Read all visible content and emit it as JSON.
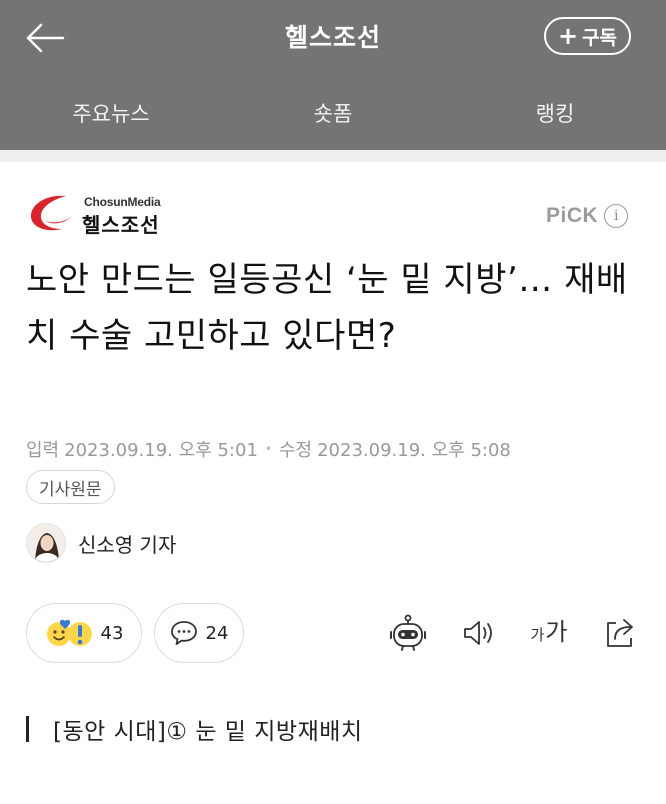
{
  "header": {
    "brand": "헬스조선",
    "subscribe_label": "구독",
    "subscribe_plus": "+"
  },
  "tabs": [
    {
      "label": "주요뉴스"
    },
    {
      "label": "숏폼"
    },
    {
      "label": "랭킹"
    }
  ],
  "article": {
    "publisher_en": "ChosunMedia",
    "publisher_ko": "헬스조선",
    "pick_label": "PiCK",
    "pick_info": "i",
    "headline": "노안 만드는 일등공신 ‘눈 밑 지방’… 재배치 수술 고민하고 있다면?",
    "input_label": "입력",
    "input_date": "2023.09.19. 오후 5:01",
    "edit_label": "수정",
    "edit_date": "2023.09.19. 오후 5:08",
    "separator": "•",
    "original_link": "기사원문",
    "reporter": "신소영 기자",
    "reaction_count": "43",
    "comment_count": "24",
    "fontsize_small": "가",
    "fontsize_large": "가",
    "section_title": "[동안 시대]① 눈 밑 지방재배치"
  },
  "colors": {
    "header_bg": "#747474",
    "brand_red": "#d7262b",
    "muted_text": "#999999"
  }
}
